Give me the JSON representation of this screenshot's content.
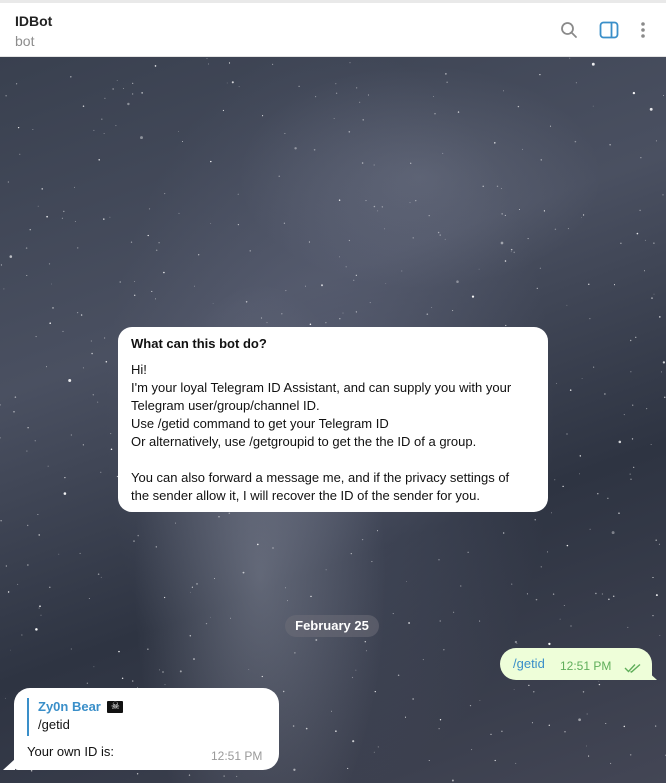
{
  "header": {
    "title": "IDBot",
    "subtitle": "bot",
    "icons": [
      "search-icon",
      "sidebar-toggle-icon",
      "more-vertical-icon"
    ],
    "accent_color": "#3a8fc9"
  },
  "intro": {
    "title": "What can this bot do?",
    "lines": [
      "Hi!",
      "I'm your loyal Telegram ID Assistant, and can supply you with your",
      "Telegram user/group/channel ID.",
      "Use /getid command to get your Telegram ID",
      "Or alternatively, use /getgroupid to get the the ID of a group.",
      "",
      "You can also forward a message me, and if the privacy settings of",
      "the sender allow it, I will recover the ID of the sender for you."
    ]
  },
  "date_separator": "February 25",
  "outgoing_message": {
    "text": "/getid",
    "time": "12:51 PM",
    "status_icon": "double-check-icon"
  },
  "incoming_message": {
    "reply_to": {
      "name": "Zy0n Bear",
      "flag_icon": "pirate-flag-icon",
      "text": "/getid"
    },
    "text": "Your own ID is:",
    "time": "12:51 PM"
  }
}
